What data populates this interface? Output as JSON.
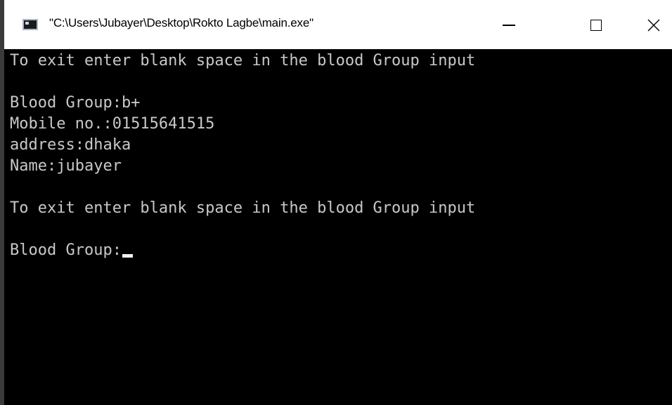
{
  "window": {
    "title": "\"C:\\Users\\Jubayer\\Desktop\\Rokto Lagbe\\main.exe\"",
    "icon": "console-app-icon",
    "controls": {
      "minimize_icon": "minimize-icon",
      "maximize_icon": "maximize-icon",
      "close_glyph": "✕"
    }
  },
  "console": {
    "background": "#000000",
    "text_color": "#c8c8c8",
    "lines": [
      "To exit enter blank space in the blood Group input",
      "",
      "Blood Group:b+",
      "Mobile no.:01515641515",
      "address:dhaka",
      "Name:jubayer",
      "",
      "To exit enter blank space in the blood Group input",
      "",
      "Blood Group:"
    ],
    "input_value": ""
  }
}
